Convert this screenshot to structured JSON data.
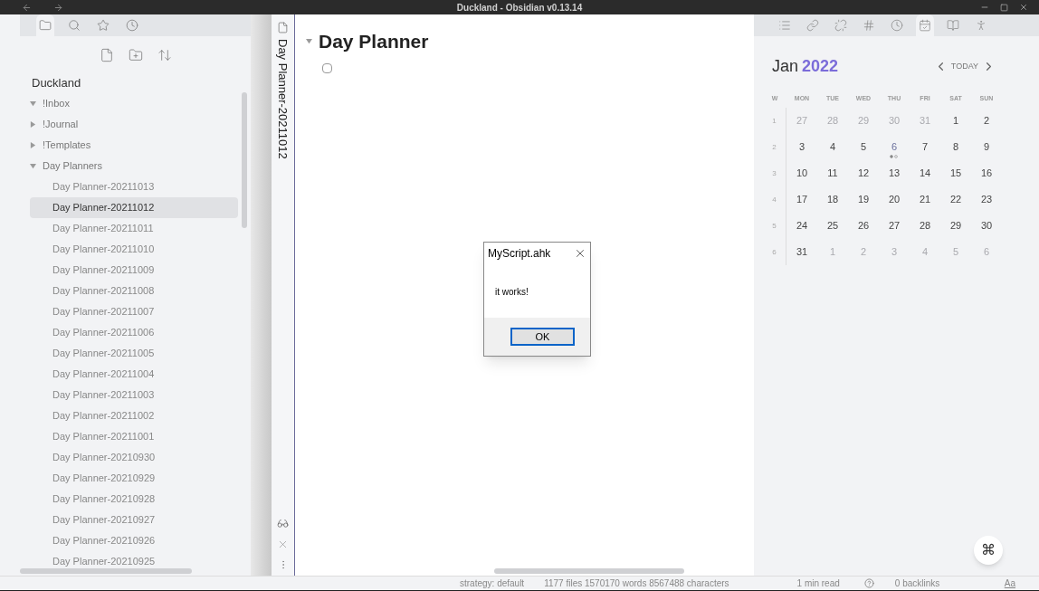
{
  "window": {
    "title": "Duckland - Obsidian v0.13.14"
  },
  "sidebar": {
    "tabs": [
      {
        "kind": "files",
        "selected": true
      },
      {
        "kind": "search",
        "selected": false
      },
      {
        "kind": "starred",
        "selected": false
      },
      {
        "kind": "recent",
        "selected": false
      }
    ],
    "vault": "Duckland",
    "tree": [
      {
        "name": "!Inbox",
        "expanded": true
      },
      {
        "name": "!Journal",
        "expanded": false
      },
      {
        "name": "!Templates",
        "expanded": false
      },
      {
        "name": "Day Planners",
        "expanded": true,
        "children": [
          {
            "name": "Day Planner-20211013",
            "selected": false
          },
          {
            "name": "Day Planner-20211012",
            "selected": true
          },
          {
            "name": "Day Planner-20211011",
            "selected": false
          },
          {
            "name": "Day Planner-20211010",
            "selected": false
          },
          {
            "name": "Day Planner-20211009",
            "selected": false
          },
          {
            "name": "Day Planner-20211008",
            "selected": false
          },
          {
            "name": "Day Planner-20211007",
            "selected": false
          },
          {
            "name": "Day Planner-20211006",
            "selected": false
          },
          {
            "name": "Day Planner-20211005",
            "selected": false
          },
          {
            "name": "Day Planner-20211004",
            "selected": false
          },
          {
            "name": "Day Planner-20211003",
            "selected": false
          },
          {
            "name": "Day Planner-20211002",
            "selected": false
          },
          {
            "name": "Day Planner-20211001",
            "selected": false
          },
          {
            "name": "Day Planner-20210930",
            "selected": false
          },
          {
            "name": "Day Planner-20210929",
            "selected": false
          },
          {
            "name": "Day Planner-20210928",
            "selected": false
          },
          {
            "name": "Day Planner-20210927",
            "selected": false
          },
          {
            "name": "Day Planner-20210926",
            "selected": false
          },
          {
            "name": "Day Planner-20210925",
            "selected": false
          }
        ]
      }
    ]
  },
  "editor": {
    "tab_title": "Day Planner-20211012",
    "heading": "Day Planner",
    "task": {
      "checked": false
    }
  },
  "right_panel": {
    "tabs": [
      {
        "kind": "outline",
        "selected": false
      },
      {
        "kind": "backlinks",
        "selected": false
      },
      {
        "kind": "outgoing",
        "selected": false
      },
      {
        "kind": "tags",
        "selected": false
      },
      {
        "kind": "recent",
        "selected": false
      },
      {
        "kind": "calendar",
        "selected": true
      },
      {
        "kind": "reading",
        "selected": false
      },
      {
        "kind": "activity",
        "selected": false
      }
    ],
    "calendar": {
      "month": "Jan",
      "year": "2022",
      "today_label": "TODAY",
      "headers": [
        "W",
        "MON",
        "TUE",
        "WED",
        "THU",
        "FRI",
        "SAT",
        "SUN"
      ],
      "weeks": [
        {
          "week": "1",
          "days": [
            {
              "label": "27",
              "outside": true,
              "today": false
            },
            {
              "label": "28",
              "outside": true,
              "today": false
            },
            {
              "label": "29",
              "outside": true,
              "today": false
            },
            {
              "label": "30",
              "outside": true,
              "today": false
            },
            {
              "label": "31",
              "outside": true,
              "today": false
            },
            {
              "label": "1",
              "outside": false,
              "today": false
            },
            {
              "label": "2",
              "outside": false,
              "today": false
            }
          ]
        },
        {
          "week": "2",
          "days": [
            {
              "label": "3",
              "outside": false,
              "today": false
            },
            {
              "label": "4",
              "outside": false,
              "today": false
            },
            {
              "label": "5",
              "outside": false,
              "today": false
            },
            {
              "label": "6",
              "outside": false,
              "today": true,
              "dots": [
                true,
                false
              ]
            },
            {
              "label": "7",
              "outside": false,
              "today": false
            },
            {
              "label": "8",
              "outside": false,
              "today": false
            },
            {
              "label": "9",
              "outside": false,
              "today": false
            }
          ]
        },
        {
          "week": "3",
          "days": [
            {
              "label": "10",
              "outside": false,
              "today": false
            },
            {
              "label": "11",
              "outside": false,
              "today": false
            },
            {
              "label": "12",
              "outside": false,
              "today": false
            },
            {
              "label": "13",
              "outside": false,
              "today": false
            },
            {
              "label": "14",
              "outside": false,
              "today": false
            },
            {
              "label": "15",
              "outside": false,
              "today": false
            },
            {
              "label": "16",
              "outside": false,
              "today": false
            }
          ]
        },
        {
          "week": "4",
          "days": [
            {
              "label": "17",
              "outside": false,
              "today": false
            },
            {
              "label": "18",
              "outside": false,
              "today": false
            },
            {
              "label": "19",
              "outside": false,
              "today": false
            },
            {
              "label": "20",
              "outside": false,
              "today": false
            },
            {
              "label": "21",
              "outside": false,
              "today": false
            },
            {
              "label": "22",
              "outside": false,
              "today": false
            },
            {
              "label": "23",
              "outside": false,
              "today": false
            }
          ]
        },
        {
          "week": "5",
          "days": [
            {
              "label": "24",
              "outside": false,
              "today": false
            },
            {
              "label": "25",
              "outside": false,
              "today": false
            },
            {
              "label": "26",
              "outside": false,
              "today": false
            },
            {
              "label": "27",
              "outside": false,
              "today": false
            },
            {
              "label": "28",
              "outside": false,
              "today": false
            },
            {
              "label": "29",
              "outside": false,
              "today": false
            },
            {
              "label": "30",
              "outside": false,
              "today": false
            }
          ]
        },
        {
          "week": "6",
          "days": [
            {
              "label": "31",
              "outside": false,
              "today": false
            },
            {
              "label": "1",
              "outside": true,
              "today": false
            },
            {
              "label": "2",
              "outside": true,
              "today": false
            },
            {
              "label": "3",
              "outside": true,
              "today": false
            },
            {
              "label": "4",
              "outside": true,
              "today": false
            },
            {
              "label": "5",
              "outside": true,
              "today": false
            },
            {
              "label": "6",
              "outside": true,
              "today": false
            }
          ]
        }
      ]
    },
    "command_button": "⌘"
  },
  "dialog": {
    "title": "MyScript.ahk",
    "message": "it works!",
    "button": "OK"
  },
  "status_bar": {
    "strategy": "strategy: default",
    "counts": "1177 files 1570170 words 8567488 characters",
    "read_time": "1 min read",
    "backlinks": "0 backlinks",
    "font_button": "Aa"
  }
}
